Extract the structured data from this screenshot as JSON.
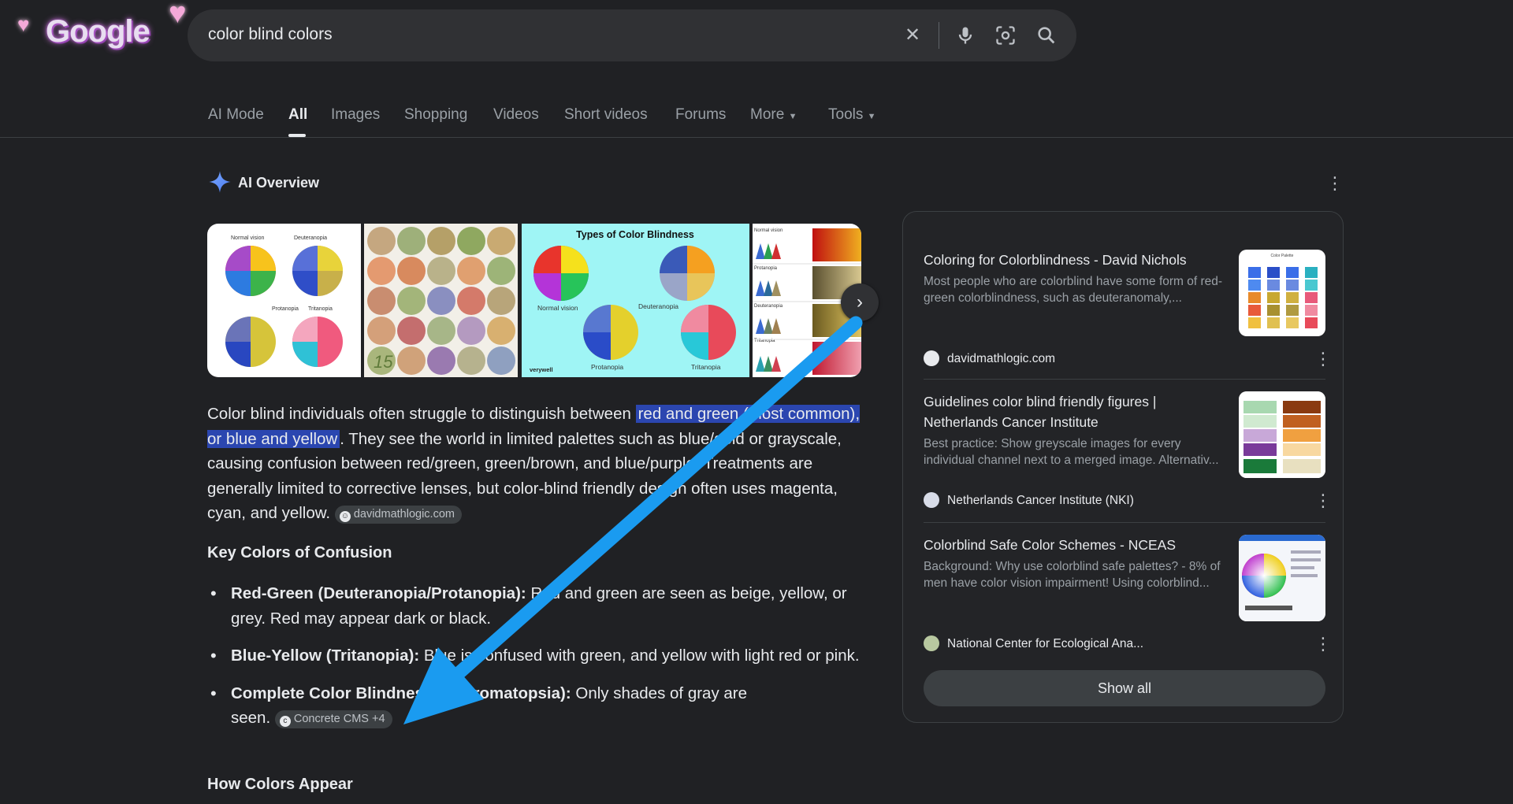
{
  "search": {
    "query": "color blind colors"
  },
  "logo": {
    "text": "Google"
  },
  "tabs": [
    "AI Mode",
    "All",
    "Images",
    "Shopping",
    "Videos",
    "Short videos",
    "Forums",
    "More",
    "Tools"
  ],
  "ai_overview": {
    "title": "AI Overview",
    "image_text": {
      "img1": [
        "Normal vision",
        "Deuteranopia",
        "Protanopia",
        "Tritanopia"
      ],
      "img3_title": "Types of Color Blindness",
      "img3_labels": [
        "Normal vision",
        "Deuteranopia",
        "Protanopia",
        "Tritanopia"
      ],
      "img3_brand": "verywell",
      "img2_number": "15",
      "img4_labels": [
        "Normal vision",
        "Protanopia",
        "Deuteranopia",
        "Tritanopia"
      ]
    },
    "paragraph": {
      "p1": "Color blind individuals often struggle to distinguish between ",
      "highlight": "red and green (most common), or blue and yellow",
      "p2": ". They see the world in limited palettes such as blue/gold or grayscale, causing confusion between red/green, green/brown, and blue/purple. Treatments are generally limited to corrective lenses, but color-blind friendly design often uses magenta, cyan, and yellow.",
      "chip": "davidmathlogic.com"
    },
    "heading1": "Key Colors of Confusion",
    "bullets": [
      {
        "bold": "Red-Green (Deuteranopia/Protanopia):",
        "text": " Red and green are seen as beige, yellow, or grey. Red may appear dark or black."
      },
      {
        "bold": "Blue-Yellow (Tritanopia):",
        "text": " Blue is confused with green, and yellow with light red or pink."
      },
      {
        "bold": "Complete Color Blindness (Achromatopsia):",
        "text": " Only shades of gray are seen.",
        "chip": "Concrete CMS +4"
      }
    ],
    "heading2": "How Colors Appear"
  },
  "sources": [
    {
      "title": "Coloring for Colorblindness - David Nichols",
      "snippet": "Most people who are colorblind have some form of red-green colorblindness, such as deuteranomaly,...",
      "site": "davidmathlogic.com",
      "img_label": "Color Palette"
    },
    {
      "title": "Guidelines color blind friendly figures | Netherlands Cancer Institute",
      "snippet": "Best practice: Show greyscale images for every individual channel next to a merged image. Alternativ...",
      "site": "Netherlands Cancer Institute (NKI)"
    },
    {
      "title": "Colorblind Safe Color Schemes - NCEAS",
      "snippet": "Background: Why use colorblind safe palettes? - 8% of men have color vision impairment! Using colorblind...",
      "site": "National Center for Ecological Ana..."
    }
  ],
  "show_all": "Show all",
  "colors": {
    "background": "#202124",
    "search_bg": "#303134",
    "highlight": "#2b46b0",
    "arrow": "#1a9bf0"
  }
}
